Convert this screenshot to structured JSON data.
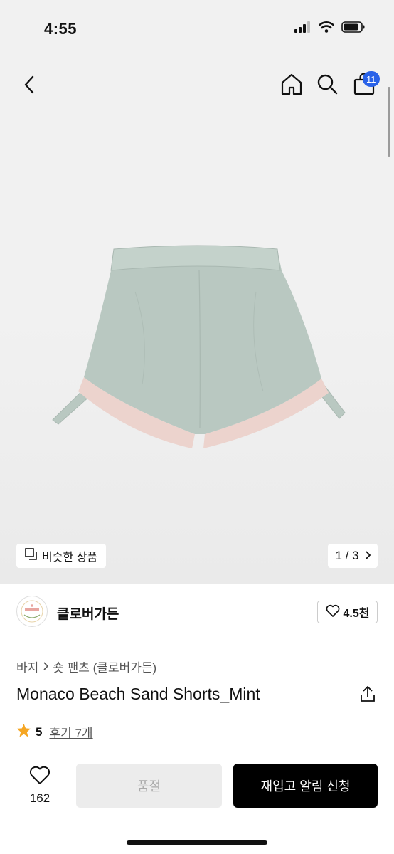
{
  "status_bar": {
    "time": "4:55"
  },
  "nav": {
    "cart_count": "11"
  },
  "gallery": {
    "similar_label": "비슷한 상품",
    "page_indicator": "1 / 3"
  },
  "brand": {
    "name": "클로버가든",
    "likes": "4.5천"
  },
  "breadcrumb": {
    "category": "바지",
    "subcategory": "숏 팬츠 (클로버가든)"
  },
  "product": {
    "title": "Monaco Beach Sand Shorts_Mint",
    "rating": "5",
    "reviews": "후기 7개"
  },
  "actions": {
    "wish_count": "162",
    "soldout_label": "품절",
    "restock_label": "재입고 알림 신청"
  },
  "colors": {
    "badge": "#2a62e8",
    "star": "#f5a623",
    "shorts_mint": "#b9c8c1",
    "shorts_pink": "#ecd3cd"
  }
}
